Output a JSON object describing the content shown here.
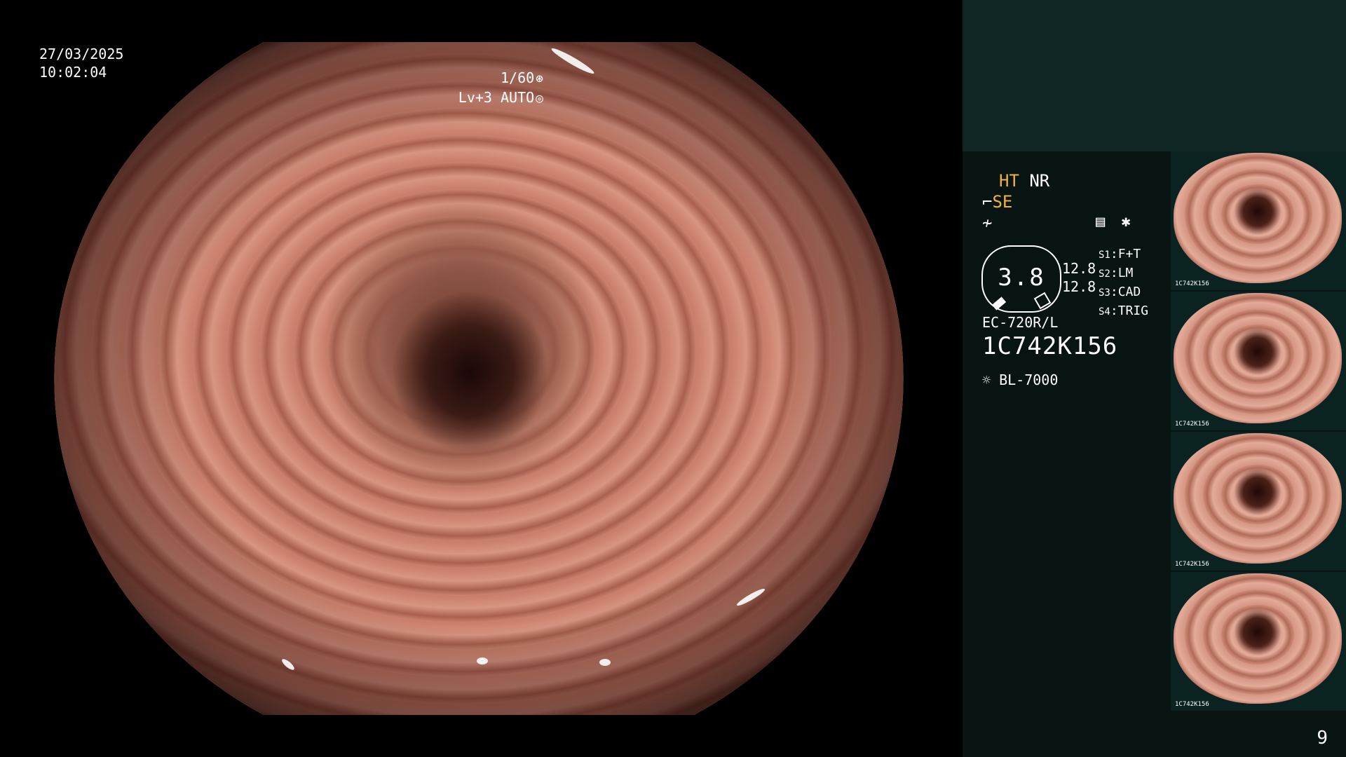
{
  "video": {
    "date": "27/03/2025",
    "time": "10:02:04",
    "shutter": "1/60",
    "iris": "Lv+3 AUTO"
  },
  "panel": {
    "ht_label": "HT",
    "nr_label": "NR",
    "se_label": "SE",
    "zoom_value": "3.8",
    "zoom_min": "12.8",
    "zoom_max": "12.8",
    "switches": [
      {
        "key": "S1",
        "value": "F+T"
      },
      {
        "key": "S2",
        "value": "LM"
      },
      {
        "key": "S3",
        "value": "CAD"
      },
      {
        "key": "S4",
        "value": "TRIG"
      }
    ],
    "scope_model": "EC-720R/L",
    "scope_serial": "1C742K156",
    "light_source": "BL-7000",
    "thumbnail_serial": "1C742K156",
    "page_number": "9"
  },
  "colors": {
    "panel_bg": "#071412",
    "panel_top_bg": "#0f2624",
    "accent_amber": "#f0b23e"
  },
  "icons": [
    "shutter-icon",
    "iris-icon",
    "lamp-icon",
    "focus-icon",
    "freeze-icon",
    "memory-icon"
  ]
}
